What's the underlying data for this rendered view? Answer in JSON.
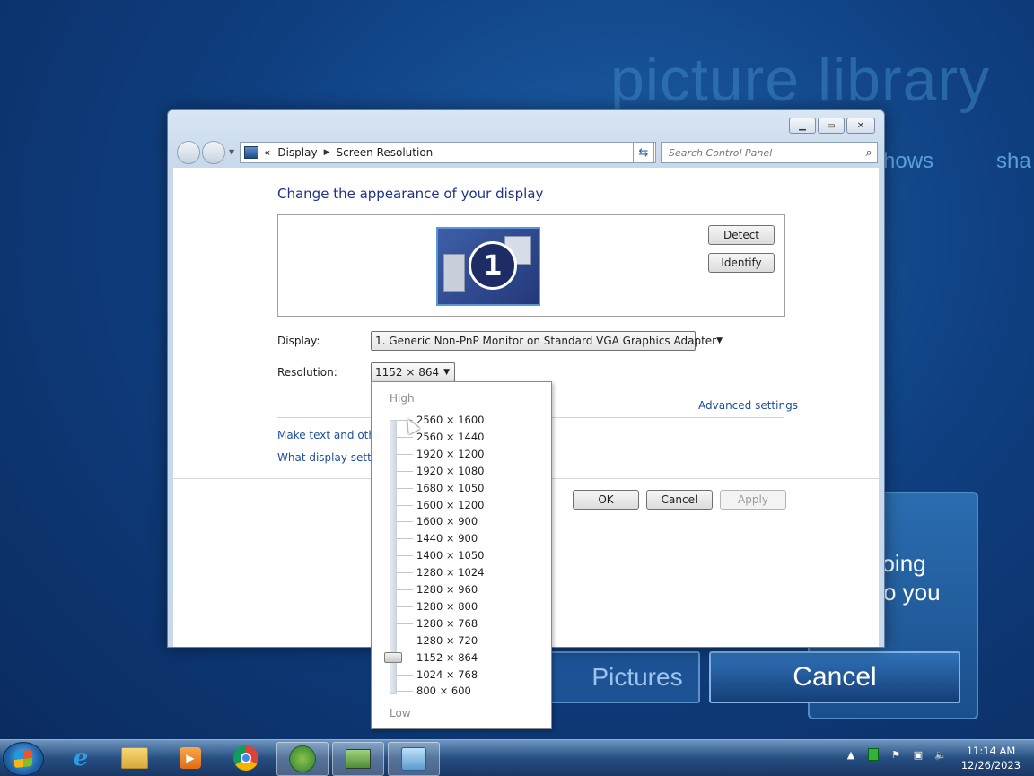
{
  "background": {
    "title": "picture library",
    "word_shows": "hows",
    "word_share": "sha",
    "going_line1": "going",
    "going_line2": "o you",
    "pictures_button": "Pictures",
    "cancel_button": "Cancel"
  },
  "window": {
    "address": {
      "prefix": "«",
      "crumb1": "Display",
      "crumb2": "Screen Resolution"
    },
    "search_placeholder": "Search Control Panel",
    "heading": "Change the appearance of your display",
    "monitor_number": "1",
    "detect_label": "Detect",
    "identify_label": "Identify",
    "display_label": "Display:",
    "display_value": "1. Generic Non-PnP Monitor on Standard VGA Graphics Adapter",
    "resolution_label": "Resolution:",
    "resolution_value": "1152 × 864",
    "advanced_link": "Advanced settings",
    "link_text_size": "Make text and other",
    "link_display_settings": "What display setting",
    "ok_label": "OK",
    "cancel_label": "Cancel",
    "apply_label": "Apply"
  },
  "dropdown": {
    "high_label": "High",
    "low_label": "Low",
    "selected": "1152 × 864",
    "resolutions": [
      "2560 × 1600",
      "2560 × 1440",
      "1920 × 1200",
      "1920 × 1080",
      "1680 × 1050",
      "1600 × 1200",
      "1600 × 900",
      "1440 × 900",
      "1400 × 1050",
      "1280 × 1024",
      "1280 × 960",
      "1280 × 800",
      "1280 × 768",
      "1280 × 720",
      "1152 × 864",
      "1024 × 768",
      "800 × 600"
    ]
  },
  "taskbar": {
    "time": "11:14 AM",
    "date": "12/26/2023"
  },
  "colors": {
    "link": "#1e4f9b",
    "heading": "#1e3287",
    "desktop": "#0f3f80"
  }
}
